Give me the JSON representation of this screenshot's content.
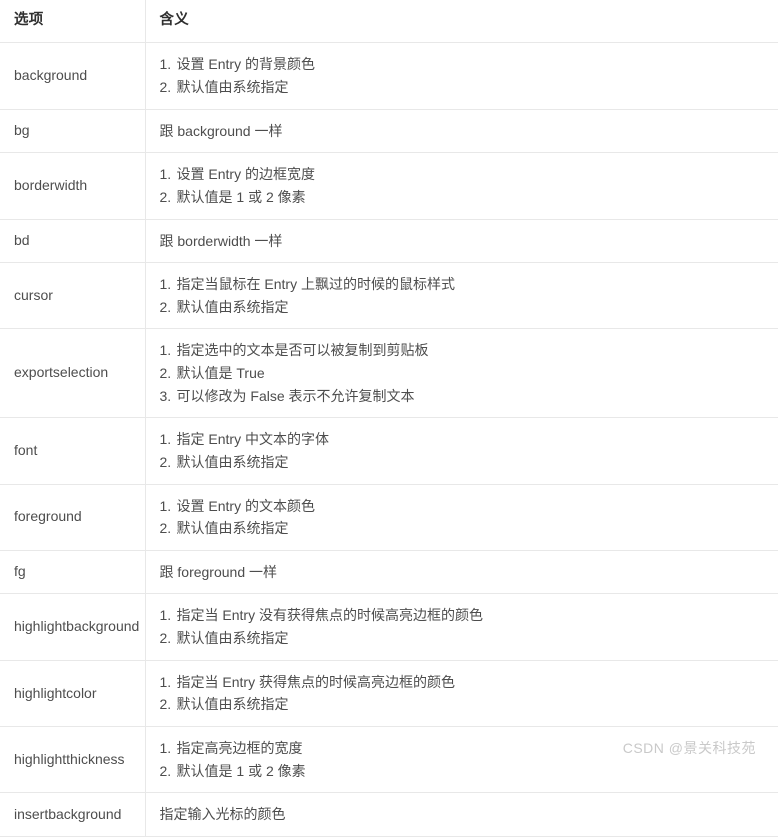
{
  "table": {
    "headers": [
      "选项",
      "含义"
    ],
    "rows": [
      {
        "option": "background",
        "items": [
          "设置 Entry 的背景颜色",
          "默认值由系统指定"
        ]
      },
      {
        "option": "bg",
        "plain": "跟 background 一样"
      },
      {
        "option": "borderwidth",
        "items": [
          "设置 Entry 的边框宽度",
          "默认值是 1 或 2 像素"
        ]
      },
      {
        "option": "bd",
        "plain": "跟 borderwidth 一样"
      },
      {
        "option": "cursor",
        "items": [
          "指定当鼠标在 Entry 上飘过的时候的鼠标样式",
          "默认值由系统指定"
        ]
      },
      {
        "option": "exportselection",
        "items": [
          "指定选中的文本是否可以被复制到剪贴板",
          "默认值是 True",
          "可以修改为 False 表示不允许复制文本"
        ]
      },
      {
        "option": "font",
        "items": [
          "指定 Entry 中文本的字体",
          "默认值由系统指定"
        ]
      },
      {
        "option": "foreground",
        "items": [
          "设置 Entry 的文本颜色",
          "默认值由系统指定"
        ]
      },
      {
        "option": "fg",
        "plain": "跟 foreground 一样"
      },
      {
        "option": "highlightbackground",
        "items": [
          "指定当 Entry 没有获得焦点的时候高亮边框的颜色",
          "默认值由系统指定"
        ]
      },
      {
        "option": "highlightcolor",
        "items": [
          "指定当 Entry 获得焦点的时候高亮边框的颜色",
          "默认值由系统指定"
        ]
      },
      {
        "option": "highlightthickness",
        "items": [
          "指定高亮边框的宽度",
          "默认值是 1 或 2 像素"
        ]
      },
      {
        "option": "insertbackground",
        "plain": "指定输入光标的颜色"
      }
    ]
  },
  "watermark": {
    "text": "CSDN @景关科技苑"
  },
  "colors": {
    "border": "#e8e8e8",
    "text": "#4d4d4d",
    "header_text": "#2f2f2f",
    "watermark": "#c9c9c9",
    "background": "#ffffff"
  }
}
